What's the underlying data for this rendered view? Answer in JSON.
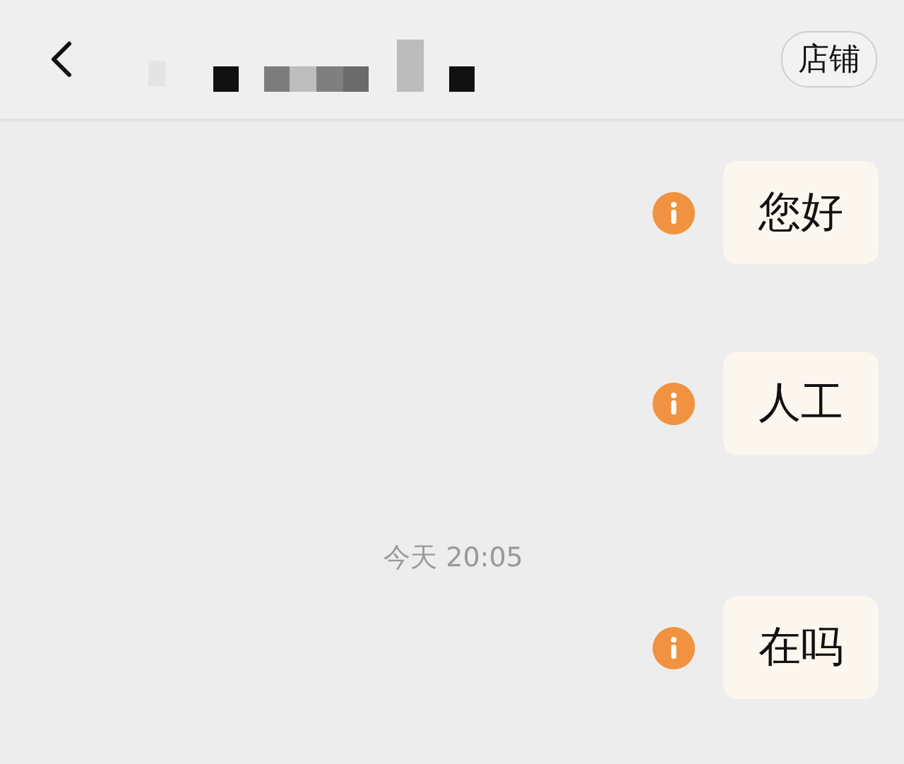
{
  "header": {
    "shop_button": "店铺"
  },
  "messages": [
    {
      "kind": "message",
      "text": "您好",
      "failed": true
    },
    {
      "kind": "message",
      "text": "人工",
      "failed": true
    },
    {
      "kind": "timestamp",
      "text": "今天 20:05"
    },
    {
      "kind": "message",
      "text": "在吗",
      "failed": true
    }
  ]
}
